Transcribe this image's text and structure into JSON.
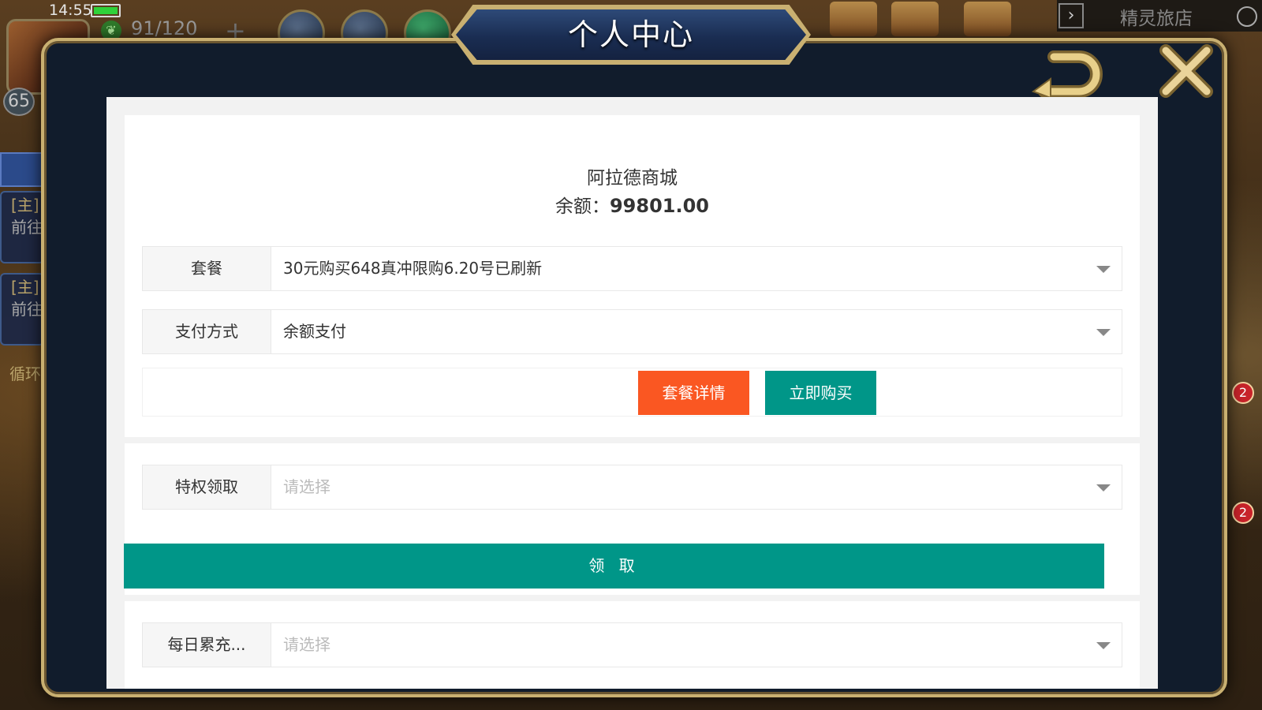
{
  "status": {
    "time": "14:55"
  },
  "hud": {
    "stamina": "91/120",
    "level": "65",
    "right_title": "精灵旅店",
    "badges": [
      "2",
      "2"
    ],
    "quests": [
      {
        "tag": "[主]",
        "sub": "前往"
      },
      {
        "tag": "[主]",
        "sub": "前往"
      }
    ],
    "loop_text": "循环"
  },
  "modal": {
    "title": "个人中心"
  },
  "shop": {
    "name": "阿拉德商城",
    "balance_label": "余额：",
    "balance_value": "99801.00",
    "package": {
      "label": "套餐",
      "value": "30元购买648真冲限购6.20号已刷新"
    },
    "payment": {
      "label": "支付方式",
      "value": "余额支付"
    },
    "details_button": "套餐详情",
    "buy_button": "立即购买",
    "privilege": {
      "label": "特权领取",
      "placeholder": "请选择"
    },
    "claim_button": "领 取",
    "daily": {
      "label": "每日累充...",
      "placeholder": "请选择"
    }
  },
  "colors": {
    "orange": "#fa5722",
    "teal": "#009688",
    "frame_gold": "#c9b071",
    "modal_bg": "#111c2c"
  }
}
